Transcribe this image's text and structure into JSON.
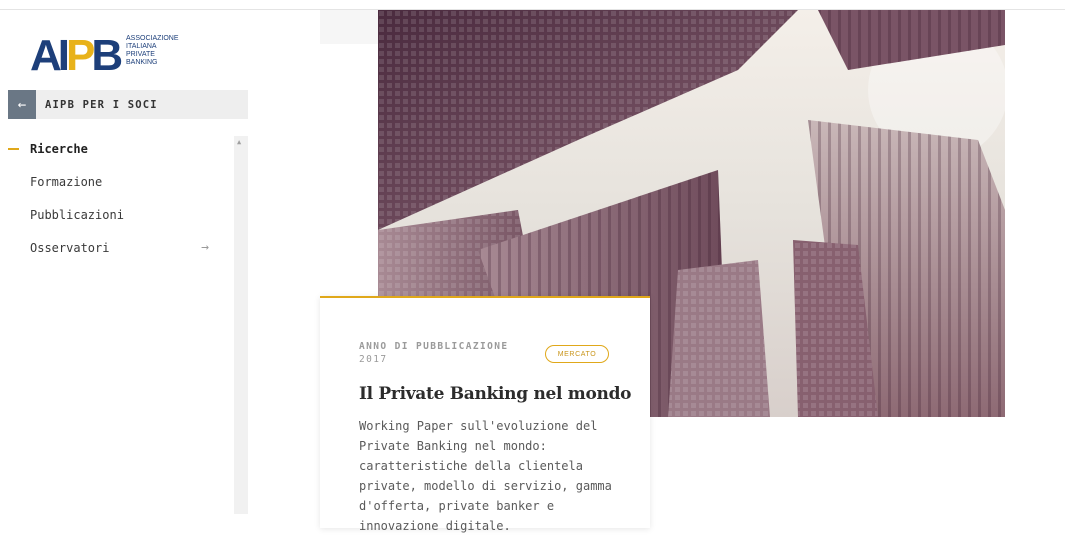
{
  "brand": {
    "logo_mark": "AIPB",
    "logo_lines": [
      "ASSOCIAZIONE",
      "ITALIANA",
      "PRIVATE",
      "BANKING"
    ]
  },
  "back_link": {
    "label": "AIPB PER I SOCI",
    "icon": "arrow-left-icon"
  },
  "nav": {
    "items": [
      {
        "label": "Ricerche",
        "active": true
      },
      {
        "label": "Formazione",
        "active": false
      },
      {
        "label": "Pubblicazioni",
        "active": false
      },
      {
        "label": "Osservatori",
        "active": false,
        "icon": "arrow-right-icon"
      }
    ]
  },
  "card": {
    "year_label": "ANNO DI PUBBLICAZIONE",
    "year_value": "2017",
    "tag": "MERCATO",
    "title": "Il Private Banking nel mondo",
    "description": "Working Paper sull'evoluzione del Private Banking nel mondo: caratteristiche della clientela private, modello di servizio, gamma d'offerta, private banker e innovazione digitale."
  },
  "colors": {
    "accent": "#e0a81a",
    "brand_blue": "#1d3f7a",
    "back_button": "#6a7785"
  }
}
